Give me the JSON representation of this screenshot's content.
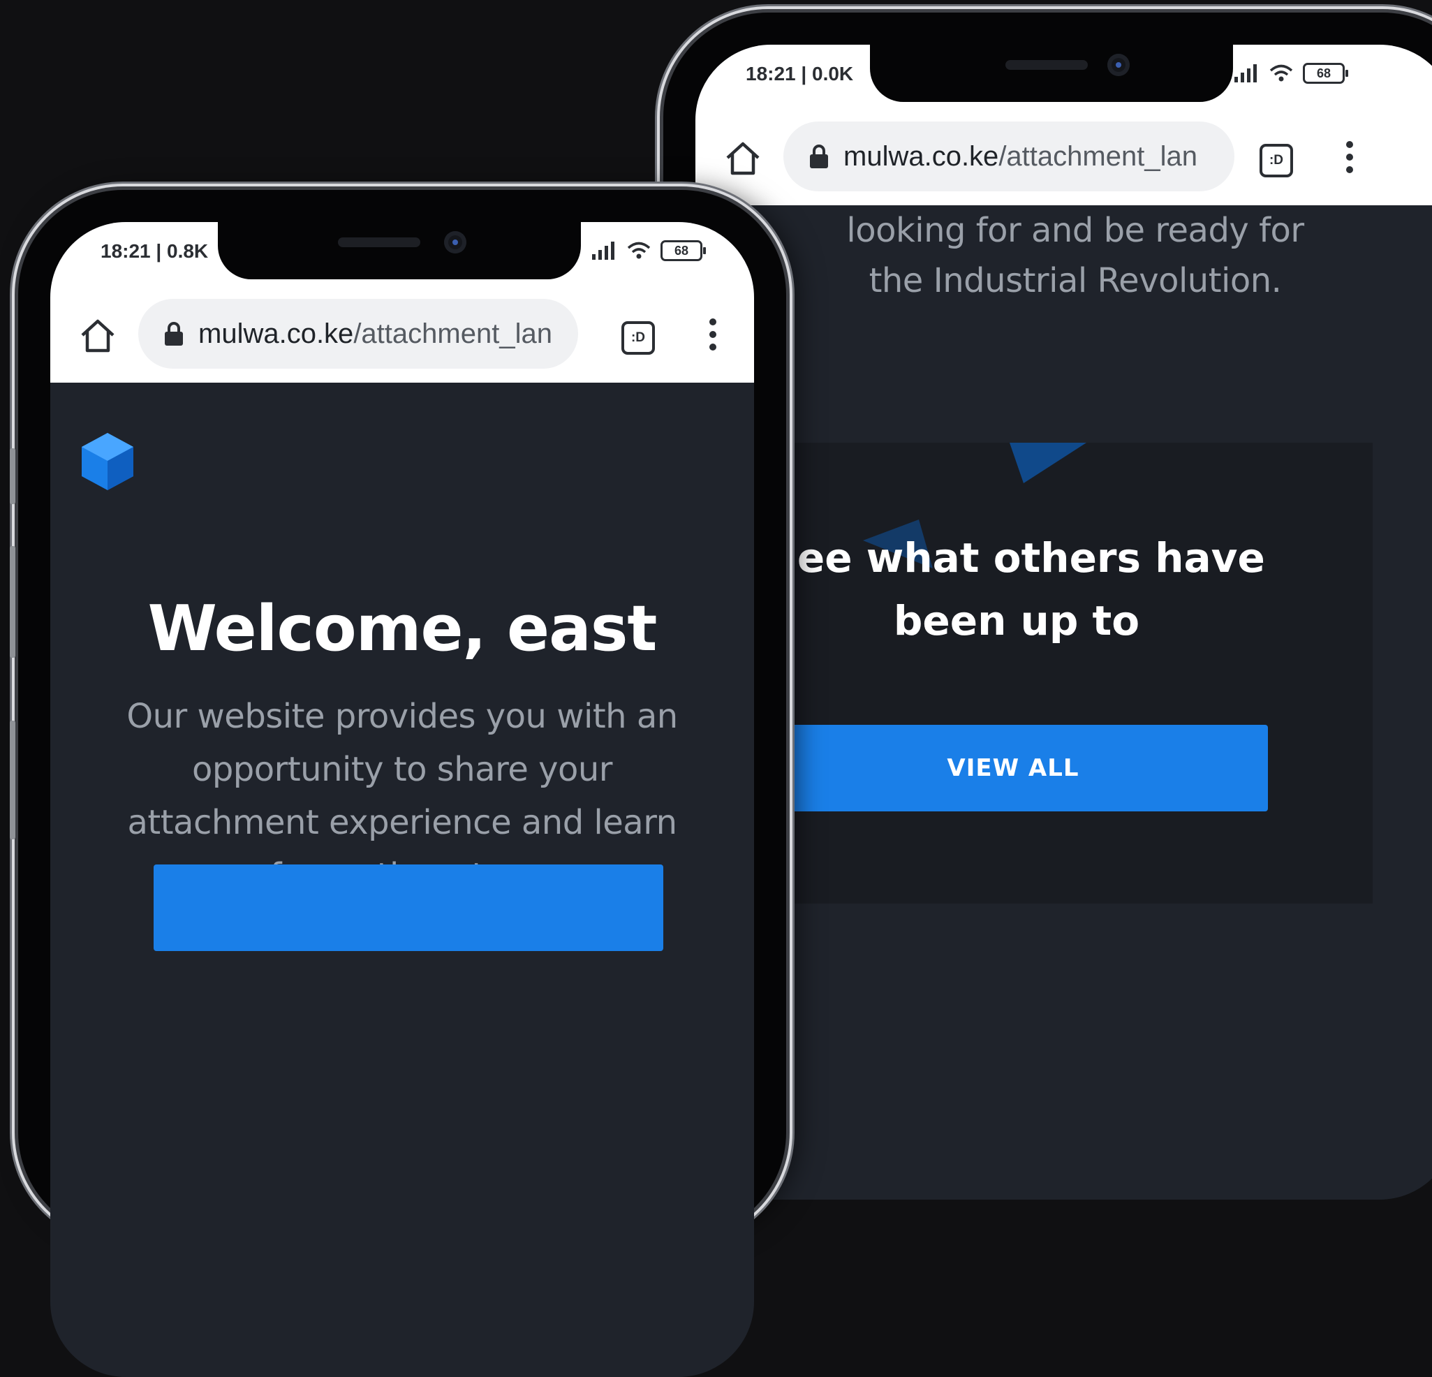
{
  "status": {
    "left_phone_time": "18:21 | 0.8K",
    "right_phone_time": "18:21 | 0.0K",
    "battery": "68"
  },
  "browser": {
    "url_domain": "mulwa.co.ke",
    "url_path": "/attachment_lan",
    "extension_label": ":D"
  },
  "left_page": {
    "title": "Welcome, east",
    "description": "Our website provides you with an opportunity to share your attachment experience and learn from others too."
  },
  "right_page": {
    "intro": "looking for and be ready for the Industrial Revolution.",
    "heading": "See what others have been up to",
    "button_label": "VIEW ALL"
  },
  "colors": {
    "page_bg": "#1f232b",
    "accent": "#1a7fe8",
    "frame_bg": "#101012"
  }
}
